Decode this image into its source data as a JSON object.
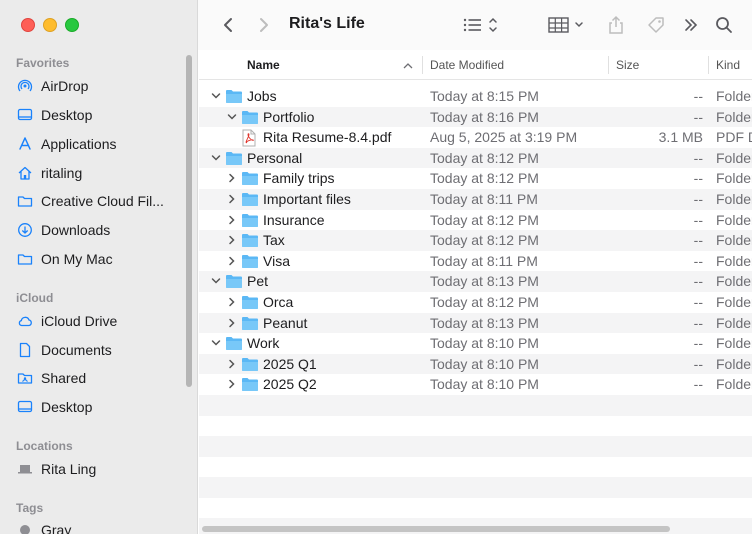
{
  "window": {
    "title": "Rita's Life"
  },
  "sidebar": {
    "sections": [
      {
        "label": "Favorites",
        "items": [
          {
            "label": "AirDrop",
            "icon": "airdrop-icon"
          },
          {
            "label": "Desktop",
            "icon": "desktop-icon"
          },
          {
            "label": "Applications",
            "icon": "applications-icon"
          },
          {
            "label": "ritaling",
            "icon": "home-icon"
          },
          {
            "label": "Creative Cloud Fil...",
            "icon": "folder-icon"
          },
          {
            "label": "Downloads",
            "icon": "downloads-icon"
          },
          {
            "label": "On My Mac",
            "icon": "folder-icon"
          }
        ]
      },
      {
        "label": "iCloud",
        "items": [
          {
            "label": "iCloud Drive",
            "icon": "cloud-icon"
          },
          {
            "label": "Documents",
            "icon": "document-icon"
          },
          {
            "label": "Shared",
            "icon": "shared-folder-icon"
          },
          {
            "label": "Desktop",
            "icon": "desktop-icon"
          }
        ]
      },
      {
        "label": "Locations",
        "items": [
          {
            "label": "Rita Ling",
            "icon": "laptop-icon"
          }
        ]
      },
      {
        "label": "Tags",
        "items": [
          {
            "label": "Gray",
            "icon": "gray-tag-dot"
          }
        ]
      }
    ]
  },
  "columns": {
    "name": "Name",
    "date": "Date Modified",
    "size": "Size",
    "kind": "Kind"
  },
  "rows": [
    {
      "level": 0,
      "disclosure": "open",
      "type": "folder",
      "name": "Jobs",
      "date": "Today at 8:15 PM",
      "size": "--",
      "kind": "Folder"
    },
    {
      "level": 1,
      "disclosure": "open",
      "type": "folder",
      "name": "Portfolio",
      "date": "Today at 8:16 PM",
      "size": "--",
      "kind": "Folder"
    },
    {
      "level": 1,
      "disclosure": "none",
      "type": "pdf",
      "name": "Rita Resume-8.4.pdf",
      "date": "Aug 5, 2025 at 3:19 PM",
      "size": "3.1 MB",
      "kind": "PDF Doc"
    },
    {
      "level": 0,
      "disclosure": "open",
      "type": "folder",
      "name": "Personal",
      "date": "Today at 8:12 PM",
      "size": "--",
      "kind": "Folder"
    },
    {
      "level": 1,
      "disclosure": "closed",
      "type": "folder",
      "name": "Family trips",
      "date": "Today at 8:12 PM",
      "size": "--",
      "kind": "Folder"
    },
    {
      "level": 1,
      "disclosure": "closed",
      "type": "folder",
      "name": "Important files",
      "date": "Today at 8:11 PM",
      "size": "--",
      "kind": "Folder"
    },
    {
      "level": 1,
      "disclosure": "closed",
      "type": "folder",
      "name": "Insurance",
      "date": "Today at 8:12 PM",
      "size": "--",
      "kind": "Folder"
    },
    {
      "level": 1,
      "disclosure": "closed",
      "type": "folder",
      "name": "Tax",
      "date": "Today at 8:12 PM",
      "size": "--",
      "kind": "Folder"
    },
    {
      "level": 1,
      "disclosure": "closed",
      "type": "folder",
      "name": "Visa",
      "date": "Today at 8:11 PM",
      "size": "--",
      "kind": "Folder"
    },
    {
      "level": 0,
      "disclosure": "open",
      "type": "folder",
      "name": "Pet",
      "date": "Today at 8:13 PM",
      "size": "--",
      "kind": "Folder"
    },
    {
      "level": 1,
      "disclosure": "closed",
      "type": "folder",
      "name": "Orca",
      "date": "Today at 8:12 PM",
      "size": "--",
      "kind": "Folder"
    },
    {
      "level": 1,
      "disclosure": "closed",
      "type": "folder",
      "name": "Peanut",
      "date": "Today at 8:13 PM",
      "size": "--",
      "kind": "Folder"
    },
    {
      "level": 0,
      "disclosure": "open",
      "type": "folder",
      "name": "Work",
      "date": "Today at 8:10 PM",
      "size": "--",
      "kind": "Folder"
    },
    {
      "level": 1,
      "disclosure": "closed",
      "type": "folder",
      "name": "2025 Q1",
      "date": "Today at 8:10 PM",
      "size": "--",
      "kind": "Folder"
    },
    {
      "level": 1,
      "disclosure": "closed",
      "type": "folder",
      "name": "2025 Q2",
      "date": "Today at 8:10 PM",
      "size": "--",
      "kind": "Folder"
    }
  ],
  "colors": {
    "accent": "#1a82fb",
    "folder": "#5bb8f5",
    "sidebar_bg": "#ebebeb",
    "stripe": "#f4f4f5"
  }
}
